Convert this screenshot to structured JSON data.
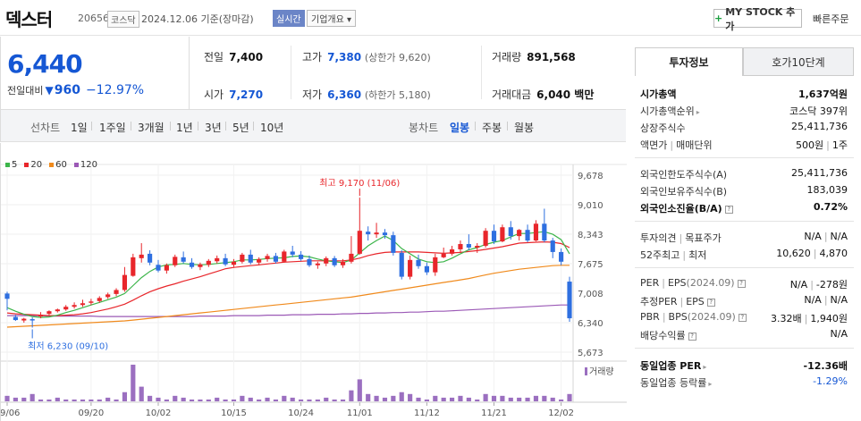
{
  "header": {
    "name": "덱스터",
    "code": "206560",
    "market": "코스닥",
    "as_of": "2024.12.06 기준(장마감)",
    "realtime_label": "실시간",
    "overview_label": "기업개요 ▾",
    "mystock_plus": "+",
    "mystock_label": "MY STOCK 추가",
    "quick_order": "빠른주문"
  },
  "price": {
    "current": "6,440",
    "change_label": "전일대비",
    "change_arrow": "▼",
    "change_value": "960",
    "change_pct": "−12.97%"
  },
  "quote": {
    "prev_label": "전일",
    "prev": "7,400",
    "high_label": "고가",
    "high": "7,380",
    "upper_limit_label": "(상한가",
    "upper_limit": "9,620)",
    "volume_label": "거래량",
    "volume": "891,568",
    "open_label": "시가",
    "open": "7,270",
    "low_label": "저가",
    "low": "6,360",
    "lower_limit_label": "(하한가",
    "lower_limit": "5,180)",
    "amount_label": "거래대금",
    "amount": "6,040 백만"
  },
  "periods": {
    "line_label": "선차트",
    "line": [
      "1일",
      "1주일",
      "3개월",
      "1년",
      "3년",
      "5년",
      "10년"
    ],
    "candle_label": "봉차트",
    "candle": [
      "일봉",
      "주봉",
      "월봉"
    ],
    "selected": "일봉"
  },
  "chart_data": {
    "type": "candlestick",
    "legend": [
      {
        "name": "5",
        "color": "#3cb54a"
      },
      {
        "name": "20",
        "color": "#e8262b"
      },
      {
        "name": "60",
        "color": "#f08a1c"
      },
      {
        "name": "120",
        "color": "#9b59b6"
      }
    ],
    "y_ticks": [
      "9,678",
      "9,010",
      "8,343",
      "7,675",
      "7,008",
      "6,340",
      "5,673"
    ],
    "y_tick_values": [
      9678,
      9010,
      8343,
      7675,
      7008,
      6340,
      5673
    ],
    "ylim": [
      5673,
      9678
    ],
    "x_ticks": [
      "09/06",
      "09/20",
      "10/02",
      "10/15",
      "10/24",
      "11/01",
      "11/12",
      "11/21",
      "12/02"
    ],
    "x_tick_index": [
      0,
      10,
      18,
      27,
      35,
      42,
      50,
      58,
      66
    ],
    "high_annotation": "최고 9,170 (11/06)",
    "low_annotation": "최저 6,230 (09/10)",
    "volume_label": "거래량",
    "up_color": "#e8262b",
    "down_color": "#2e6fe0",
    "candles": [
      [
        7000,
        7040,
        6880,
        6620
      ],
      [
        6470,
        6520,
        6400,
        6380
      ],
      [
        6390,
        6450,
        6430,
        6340
      ],
      [
        6420,
        6460,
        6390,
        6230
      ],
      [
        6480,
        6580,
        6520,
        6440
      ],
      [
        6540,
        6620,
        6600,
        6510
      ],
      [
        6600,
        6660,
        6640,
        6570
      ],
      [
        6640,
        6740,
        6700,
        6610
      ],
      [
        6700,
        6800,
        6740,
        6660
      ],
      [
        6740,
        6860,
        6780,
        6700
      ],
      [
        6790,
        6880,
        6820,
        6740
      ],
      [
        6830,
        6940,
        6900,
        6790
      ],
      [
        6920,
        7020,
        6980,
        6880
      ],
      [
        6990,
        7120,
        7080,
        6940
      ],
      [
        7080,
        7600,
        7420,
        7040
      ],
      [
        7400,
        7900,
        7820,
        7380
      ],
      [
        7800,
        8140,
        7880,
        7700
      ],
      [
        7900,
        7980,
        7700,
        7640
      ],
      [
        7650,
        7760,
        7520,
        7480
      ],
      [
        7520,
        7680,
        7640,
        7450
      ],
      [
        7640,
        7880,
        7830,
        7600
      ],
      [
        7820,
        7950,
        7720,
        7680
      ],
      [
        7700,
        7800,
        7600,
        7560
      ],
      [
        7600,
        7700,
        7660,
        7530
      ],
      [
        7650,
        7780,
        7740,
        7600
      ],
      [
        7730,
        7860,
        7800,
        7680
      ],
      [
        7800,
        7900,
        7660,
        7620
      ],
      [
        7650,
        7780,
        7720,
        7600
      ],
      [
        7720,
        7920,
        7880,
        7680
      ],
      [
        7880,
        7990,
        7700,
        7660
      ],
      [
        7700,
        7820,
        7780,
        7640
      ],
      [
        7780,
        7900,
        7850,
        7720
      ],
      [
        7850,
        7920,
        7720,
        7680
      ],
      [
        7720,
        7990,
        7950,
        7700
      ],
      [
        7950,
        8080,
        7880,
        7820
      ],
      [
        7880,
        7960,
        7780,
        7740
      ],
      [
        7780,
        7860,
        7640,
        7600
      ],
      [
        7640,
        7720,
        7680,
        7560
      ],
      [
        7680,
        7840,
        7800,
        7620
      ],
      [
        7800,
        7850,
        7640,
        7600
      ],
      [
        7640,
        7780,
        7720,
        7580
      ],
      [
        7720,
        8300,
        7900,
        7680
      ],
      [
        7900,
        9170,
        8420,
        7880
      ],
      [
        8400,
        8520,
        8340,
        8200
      ],
      [
        8340,
        8600,
        8380,
        8260
      ],
      [
        8380,
        8460,
        8320,
        8240
      ],
      [
        8320,
        8400,
        7920,
        7860
      ],
      [
        7920,
        7980,
        7380,
        7320
      ],
      [
        7380,
        7860,
        7760,
        7320
      ],
      [
        7760,
        7880,
        7620,
        7560
      ],
      [
        7620,
        7700,
        7480,
        7420
      ],
      [
        7480,
        7900,
        7820,
        7400
      ],
      [
        7820,
        8040,
        7900,
        7800
      ],
      [
        7900,
        8080,
        8000,
        7860
      ],
      [
        8000,
        8200,
        8120,
        7940
      ],
      [
        8120,
        8340,
        8040,
        7980
      ],
      [
        8040,
        8140,
        8080,
        7920
      ],
      [
        8080,
        8480,
        8420,
        8040
      ],
      [
        8420,
        8560,
        8180,
        8120
      ],
      [
        8180,
        8560,
        8500,
        8160
      ],
      [
        8500,
        8640,
        8300,
        8220
      ],
      [
        8300,
        8460,
        8440,
        8200
      ],
      [
        8440,
        8560,
        8200,
        8160
      ],
      [
        8200,
        8660,
        8580,
        8180
      ],
      [
        8580,
        8920,
        8200,
        8160
      ],
      [
        8200,
        8260,
        7940,
        7800
      ],
      [
        7940,
        8020,
        7720,
        7640
      ],
      [
        7270,
        7380,
        6440,
        6360
      ]
    ],
    "ma5": [
      6680,
      6600,
      6530,
      6480,
      6460,
      6470,
      6510,
      6570,
      6620,
      6680,
      6740,
      6800,
      6860,
      6920,
      7000,
      7180,
      7360,
      7500,
      7600,
      7650,
      7660,
      7680,
      7660,
      7650,
      7660,
      7680,
      7700,
      7720,
      7760,
      7760,
      7770,
      7790,
      7800,
      7810,
      7840,
      7850,
      7830,
      7780,
      7740,
      7720,
      7700,
      7760,
      7920,
      8080,
      8200,
      8300,
      8200,
      8020,
      7900,
      7780,
      7720,
      7700,
      7720,
      7800,
      7900,
      7990,
      8040,
      8110,
      8160,
      8200,
      8280,
      8360,
      8360,
      8380,
      8400,
      8340,
      8220,
      7900
    ],
    "ma20": [
      6560,
      6540,
      6530,
      6520,
      6510,
      6500,
      6500,
      6510,
      6520,
      6540,
      6570,
      6610,
      6650,
      6700,
      6760,
      6850,
      6950,
      7040,
      7110,
      7170,
      7220,
      7280,
      7330,
      7380,
      7440,
      7500,
      7560,
      7590,
      7610,
      7630,
      7650,
      7670,
      7690,
      7710,
      7720,
      7730,
      7740,
      7740,
      7740,
      7740,
      7740,
      7760,
      7800,
      7860,
      7900,
      7930,
      7940,
      7940,
      7940,
      7940,
      7930,
      7920,
      7910,
      7920,
      7930,
      7950,
      7970,
      8000,
      8030,
      8060,
      8100,
      8140,
      8150,
      8160,
      8170,
      8160,
      8130,
      8040
    ],
    "ma60": [
      6240,
      6250,
      6260,
      6270,
      6280,
      6290,
      6300,
      6310,
      6320,
      6330,
      6340,
      6350,
      6360,
      6370,
      6380,
      6400,
      6420,
      6440,
      6460,
      6480,
      6500,
      6520,
      6540,
      6560,
      6580,
      6600,
      6620,
      6640,
      6660,
      6680,
      6700,
      6720,
      6740,
      6760,
      6780,
      6800,
      6820,
      6840,
      6860,
      6880,
      6900,
      6920,
      6950,
      6980,
      7010,
      7040,
      7070,
      7100,
      7130,
      7160,
      7190,
      7220,
      7250,
      7280,
      7310,
      7340,
      7380,
      7420,
      7460,
      7490,
      7520,
      7550,
      7570,
      7590,
      7610,
      7630,
      7640,
      7640
    ],
    "ma120": [
      6500,
      6500,
      6500,
      6500,
      6500,
      6490,
      6490,
      6490,
      6490,
      6490,
      6490,
      6480,
      6480,
      6480,
      6480,
      6480,
      6480,
      6480,
      6480,
      6480,
      6480,
      6480,
      6480,
      6490,
      6490,
      6490,
      6490,
      6500,
      6500,
      6500,
      6500,
      6510,
      6510,
      6510,
      6520,
      6520,
      6520,
      6530,
      6530,
      6530,
      6540,
      6540,
      6550,
      6550,
      6560,
      6560,
      6570,
      6570,
      6580,
      6580,
      6590,
      6600,
      6600,
      6610,
      6620,
      6630,
      6640,
      6650,
      6660,
      6670,
      6680,
      6690,
      6700,
      6710,
      6720,
      6730,
      6740,
      6740
    ],
    "volume": [
      3,
      2,
      2,
      4,
      1,
      1,
      2,
      1,
      1,
      1,
      1,
      1,
      2,
      1,
      5,
      20,
      8,
      3,
      2,
      1,
      3,
      2,
      1,
      1,
      1,
      2,
      1,
      1,
      3,
      2,
      1,
      2,
      1,
      3,
      2,
      1,
      1,
      1,
      2,
      1,
      1,
      6,
      12,
      4,
      3,
      2,
      3,
      5,
      4,
      2,
      1,
      3,
      2,
      2,
      3,
      2,
      1,
      4,
      3,
      3,
      2,
      2,
      2,
      3,
      3,
      2,
      1,
      4
    ]
  },
  "invest_tabs": [
    "투자정보",
    "호가10단계"
  ],
  "invest": {
    "market_cap_label": "시가총액",
    "market_cap": "1,637억원",
    "rank_label": "시가총액순위",
    "rank_market": "코스닥",
    "rank_value": "397위",
    "shares_label": "상장주식수",
    "shares": "25,411,736",
    "par_label": "액면가",
    "unit_label": "매매단위",
    "par": "500원",
    "unit": "1주",
    "foreign_limit_label": "외국인한도주식수(A)",
    "foreign_limit": "25,411,736",
    "foreign_hold_label": "외국인보유주식수(B)",
    "foreign_hold": "183,039",
    "foreign_ratio_label": "외국인소진율(B/A)",
    "foreign_ratio": "0.72%",
    "opinion_label": "투자의견",
    "target_label": "목표주가",
    "opinion": "N/A",
    "target": "N/A",
    "w52_high_label": "52주최고",
    "w52_low_label": "최저",
    "w52_high": "10,620",
    "w52_low": "4,870",
    "per_label": "PER",
    "eps_label": "EPS",
    "eps_period": "(2024.09)",
    "per": "N/A",
    "eps": "-278원",
    "est_per_label": "추정PER",
    "est_eps_label": "EPS",
    "est_per": "N/A",
    "est_eps": "N/A",
    "pbr_label": "PBR",
    "bps_label": "BPS",
    "bps_period": "(2024.09)",
    "pbr": "3.32배",
    "bps": "1,940원",
    "div_label": "배당수익률",
    "div": "N/A",
    "sector_per_label": "동일업종 PER",
    "sector_per": "-12.36배",
    "sector_chg_label": "동일업종 등락률",
    "sector_chg": "-1.29%"
  }
}
